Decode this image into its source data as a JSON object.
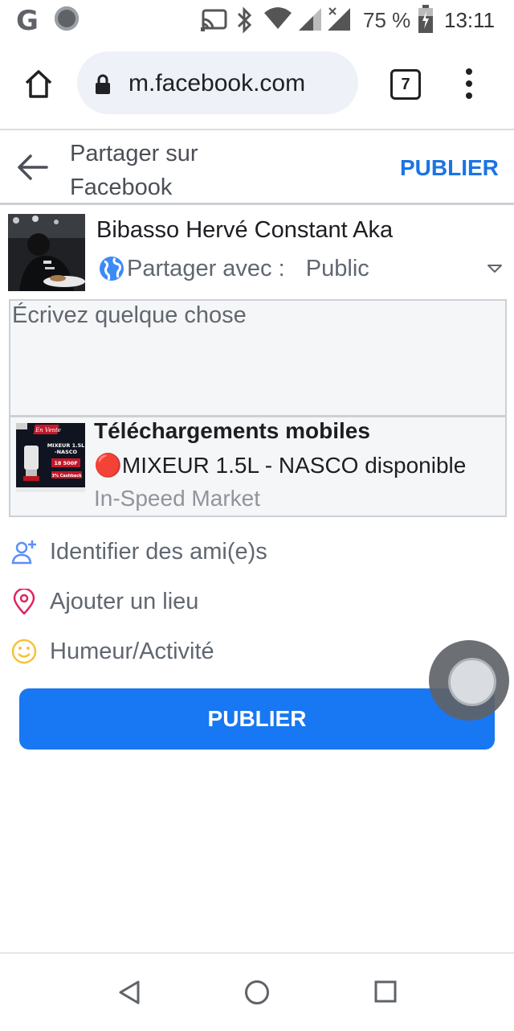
{
  "status_bar": {
    "carrier_letter": "G",
    "battery": "75 %",
    "time": "13:11"
  },
  "browser": {
    "url": "m.facebook.com",
    "tab_count": "7"
  },
  "header": {
    "title": "Partager sur Facebook",
    "publish_label": "PUBLIER"
  },
  "composer": {
    "user_name": "Bibasso Hervé Constant Aka",
    "share_with_label": "Partager avec :",
    "audience": "Public",
    "placeholder": "Écrivez quelque chose",
    "value": ""
  },
  "link_preview": {
    "title": "Téléchargements mobiles",
    "description": "🔴MIXEUR 1.5L - NASCO disponible",
    "source": "In-Speed Market",
    "thumb": {
      "badge": "En Vente",
      "line1": "MIXEUR 1.5L",
      "line2": "-NASCO",
      "price": "18 500F",
      "cashback": "3% Cashback"
    }
  },
  "options": [
    {
      "label": "Identifier des ami(e)s",
      "icon": "tag-friends-icon",
      "color": "#5b8ff9"
    },
    {
      "label": "Ajouter un lieu",
      "icon": "location-pin-icon",
      "color": "#e0245e"
    },
    {
      "label": "Humeur/Activité",
      "icon": "smiley-icon",
      "color": "#f5c33b"
    }
  ],
  "publish_button_label": "PUBLIER",
  "colors": {
    "accent": "#1877f2",
    "link_blue": "#1b74e4"
  }
}
